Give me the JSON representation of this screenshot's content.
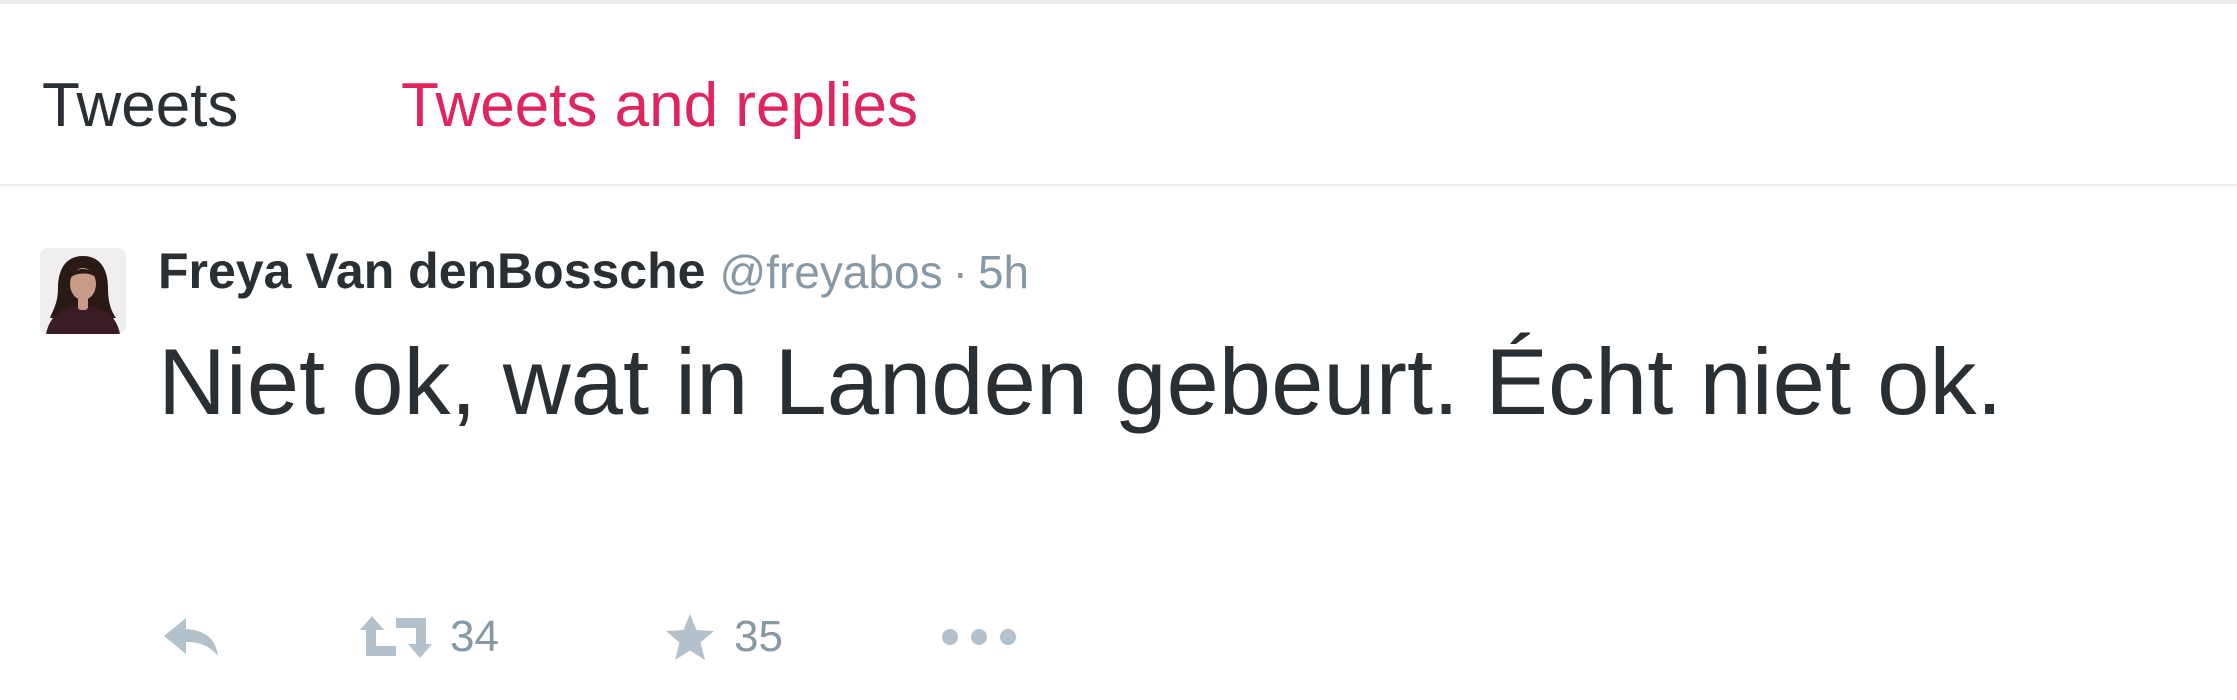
{
  "colors": {
    "accent": "#e0245e",
    "text": "#292f33",
    "muted": "#8899a6",
    "icon": "#b3c1cc"
  },
  "tabs": [
    {
      "label": "Tweets",
      "active": false
    },
    {
      "label": "Tweets and replies",
      "active": true
    }
  ],
  "tweet": {
    "fullname": "Freya Van denBossche",
    "username": "@freyabos",
    "separator": "·",
    "time": "5h",
    "text": "Niet ok, wat in Landen gebeurt. Écht niet ok.",
    "actions": {
      "reply_icon": "reply-icon",
      "retweet_icon": "retweet-icon",
      "retweet_count": "34",
      "favorite_icon": "star-icon",
      "favorite_count": "35",
      "more_icon": "more-dots-icon"
    }
  }
}
